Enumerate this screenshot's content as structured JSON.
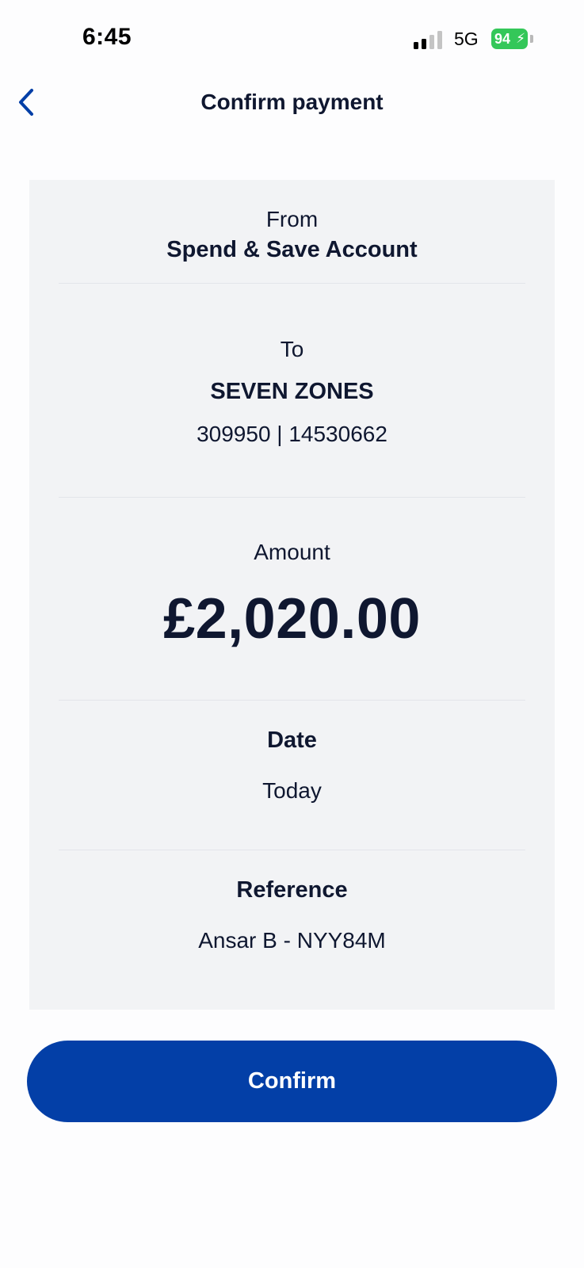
{
  "status_bar": {
    "time": "6:45",
    "network": "5G",
    "battery_level": "94",
    "battery_color": "#34c759",
    "signal_bars_active": 2,
    "signal_bars_total": 4,
    "charging_icon": "bolt-icon"
  },
  "header": {
    "title": "Confirm payment",
    "back_icon": "chevron-left-icon",
    "accent_color": "#033fa7"
  },
  "from": {
    "label": "From",
    "account_name": "Spend & Save Account"
  },
  "to": {
    "label": "To",
    "payee_name": "SEVEN ZONES",
    "account_details": "309950 | 14530662"
  },
  "amount": {
    "label": "Amount",
    "value": "£2,020.00"
  },
  "date": {
    "label": "Date",
    "value": "Today"
  },
  "reference": {
    "label": "Reference",
    "value": "Ansar B - NYY84M"
  },
  "actions": {
    "confirm_label": "Confirm",
    "confirm_color": "#033fa7"
  }
}
